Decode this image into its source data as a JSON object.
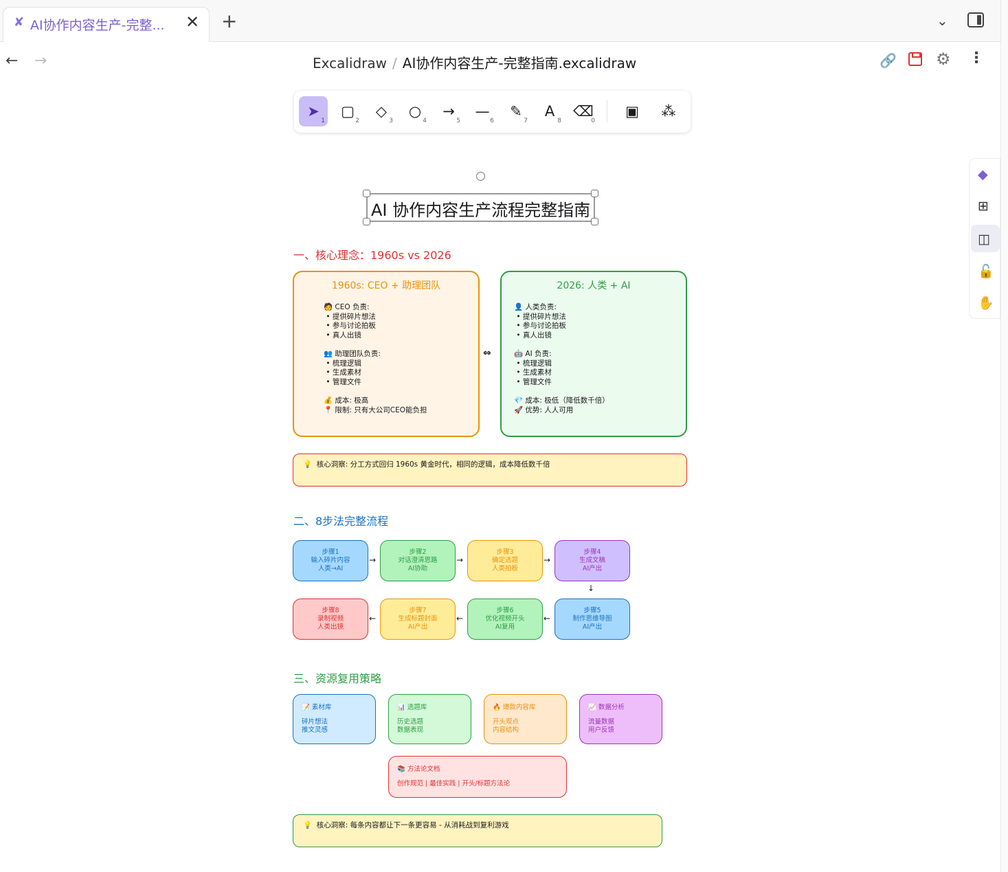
{
  "tabs": [
    {
      "title": "AI协作内容生产-完整...",
      "icon": "excalidraw-icon"
    }
  ],
  "breadcrumb": {
    "root": "Excalidraw",
    "separator": "/",
    "file": "AI协作内容生产-完整指南.excalidraw"
  },
  "toolbar": {
    "tools": [
      {
        "name": "selection",
        "glyph": "➤",
        "key": "1"
      },
      {
        "name": "rectangle",
        "glyph": "▢",
        "key": "2"
      },
      {
        "name": "diamond",
        "glyph": "◇",
        "key": "3"
      },
      {
        "name": "ellipse",
        "glyph": "○",
        "key": "4"
      },
      {
        "name": "arrow",
        "glyph": "→",
        "key": "5"
      },
      {
        "name": "line",
        "glyph": "—",
        "key": "6"
      },
      {
        "name": "draw",
        "glyph": "✎",
        "key": "7"
      },
      {
        "name": "text",
        "glyph": "A",
        "key": "8"
      },
      {
        "name": "eraser",
        "glyph": "⌫",
        "key": "0"
      },
      {
        "name": "image",
        "glyph": "▣",
        "key": ""
      },
      {
        "name": "shapes",
        "glyph": "⁂",
        "key": ""
      }
    ]
  },
  "canvas": {
    "title": "AI 协作内容生产流程完整指南",
    "section1": {
      "heading": "一、核心理念：1960s vs 2026",
      "left": {
        "title": "1960s: CEO + 助理团队",
        "body": "🧑 CEO 负责:\n • 提供碎片想法\n • 参与讨论拍板\n • 真人出镜\n\n👥 助理团队负责:\n • 梳理逻辑\n • 生成素材\n • 管理文件\n\n💰 成本: 极高\n📍 限制: 只有大公司CEO能负担"
      },
      "right": {
        "title": "2026: 人类 + AI",
        "body": "👤 人类负责:\n • 提供碎片想法\n • 参与讨论拍板\n • 真人出镜\n\n🤖 AI 负责:\n • 梳理逻辑\n • 生成素材\n • 管理文件\n\n💎 成本: 极低（降低数千倍）\n🚀 优势: 人人可用"
      },
      "insight": "💡  核心洞察: 分工方式回归 1960s 黄金时代，相同的逻辑，成本降低数千倍"
    },
    "section2": {
      "heading": "二、8步法完整流程",
      "steps": [
        {
          "text": "步骤1\n输入碎片内容\n人类→AI"
        },
        {
          "text": "步骤2\n对话澄清思路\nAI协助"
        },
        {
          "text": "步骤3\n确定选题\n人类拍板"
        },
        {
          "text": "步骤4\n生成文稿\nAI产出"
        },
        {
          "text": "步骤5\n制作思维导图\nAI产出"
        },
        {
          "text": "步骤6\n优化视频开头\nAI复用"
        },
        {
          "text": "步骤7\n生成标题封面\nAI产出"
        },
        {
          "text": "步骤8\n录制视频\n人类出镜"
        }
      ]
    },
    "section3": {
      "heading": "三、资源复用策略",
      "resources": [
        {
          "title": "📝 素材库",
          "body": "碎片想法\n推文灵感"
        },
        {
          "title": "📊 选题库",
          "body": "历史选题\n数据表现"
        },
        {
          "title": "🔥 爆款内容库",
          "body": "开头观点\n内容结构"
        },
        {
          "title": "📈 数据分析",
          "body": "流量数据\n用户反馈"
        }
      ],
      "method": {
        "title": "📚 方法论文档",
        "body": "创作规范 | 最佳实践 | 开头/标题方法论"
      },
      "insight": "💡  核心洞察: 每条内容都让下一条更容易 - 从消耗战到复利游戏"
    }
  },
  "colors": {
    "accent": "#7b61d1",
    "orange": "#e8930c",
    "green": "#2f9e44",
    "red": "#e03131",
    "blue": "#1971c2",
    "purple": "#9c36b5"
  }
}
